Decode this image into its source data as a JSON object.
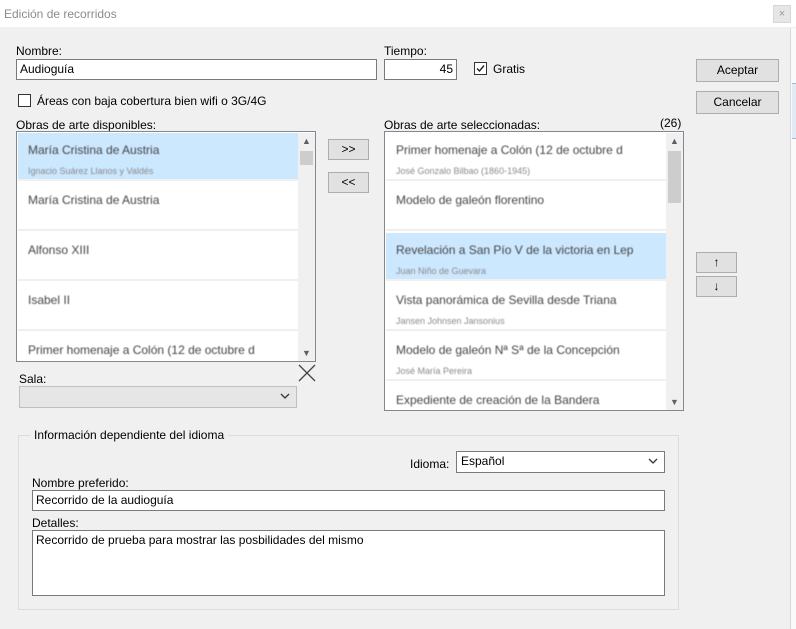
{
  "window": {
    "title": "Edición de recorridos",
    "close_glyph": "×"
  },
  "form": {
    "nombre_label": "Nombre:",
    "nombre_value": "Audioguía",
    "tiempo_label": "Tiempo:",
    "tiempo_value": "45",
    "gratis_label": "Gratis",
    "gratis_checked": true,
    "baja_cobertura_label": "Áreas con baja cobertura bien wifi o 3G/4G",
    "baja_cobertura_checked": false
  },
  "buttons": {
    "accept": "Aceptar",
    "cancel": "Cancelar",
    "add": ">>",
    "remove": "<<",
    "up": "↑",
    "down": "↓"
  },
  "available": {
    "label": "Obras de arte disponibles:",
    "items": [
      {
        "title": "María Cristina de Austria",
        "subtitle": "Ignacio Suárez Llanos y Valdés",
        "selected": true
      },
      {
        "title": "María Cristina de Austria",
        "subtitle": "",
        "selected": false
      },
      {
        "title": "Alfonso XIII",
        "subtitle": "",
        "selected": false
      },
      {
        "title": "Isabel II",
        "subtitle": "",
        "selected": false
      },
      {
        "title": "Primer homenaje a Colón (12 de octubre d",
        "subtitle": "",
        "selected": false
      }
    ]
  },
  "selected": {
    "label": "Obras de arte seleccionadas:",
    "count": "(26)",
    "items": [
      {
        "title": "Primer homenaje a Colón (12 de octubre d",
        "subtitle": "José Gonzalo Bilbao (1860-1945)",
        "selected": false
      },
      {
        "title": "Modelo de galeón florentino",
        "subtitle": "",
        "selected": false
      },
      {
        "title": "Revelación a San Pío V de la victoria en Lep",
        "subtitle": "Juan Niño de Guevara",
        "selected": true
      },
      {
        "title": "Vista panorámica de Sevilla desde Triana",
        "subtitle": "Jansen Johnsen Jansonius",
        "selected": false
      },
      {
        "title": "Modelo de galeón Nª Sª de la Concepción",
        "subtitle": "José María Pereira",
        "selected": false
      },
      {
        "title": "Expediente de creación de la Bandera",
        "subtitle": "",
        "selected": false
      }
    ]
  },
  "sala": {
    "label": "Sala:",
    "value": ""
  },
  "language_group": {
    "title": "Información dependiente del idioma",
    "idioma_label": "Idioma:",
    "idioma_value": "Español",
    "nombre_pref_label": "Nombre preferido:",
    "nombre_pref_value": "Recorrido de la audioguía",
    "detalles_label": "Detalles:",
    "detalles_value": "Recorrido de prueba para mostrar las posbilidades del mismo"
  },
  "icons": {
    "close": "close-icon",
    "clear_selection": "x-clear-icon",
    "check": "checkmark-icon",
    "dropdown": "chevron-down-icon",
    "scroll_up": "scroll-up-icon",
    "scroll_down": "scroll-down-icon"
  },
  "colors": {
    "selection": "#cce8ff",
    "dialog_bg": "#f0f0f0",
    "button_bg": "#e1e1e1"
  }
}
